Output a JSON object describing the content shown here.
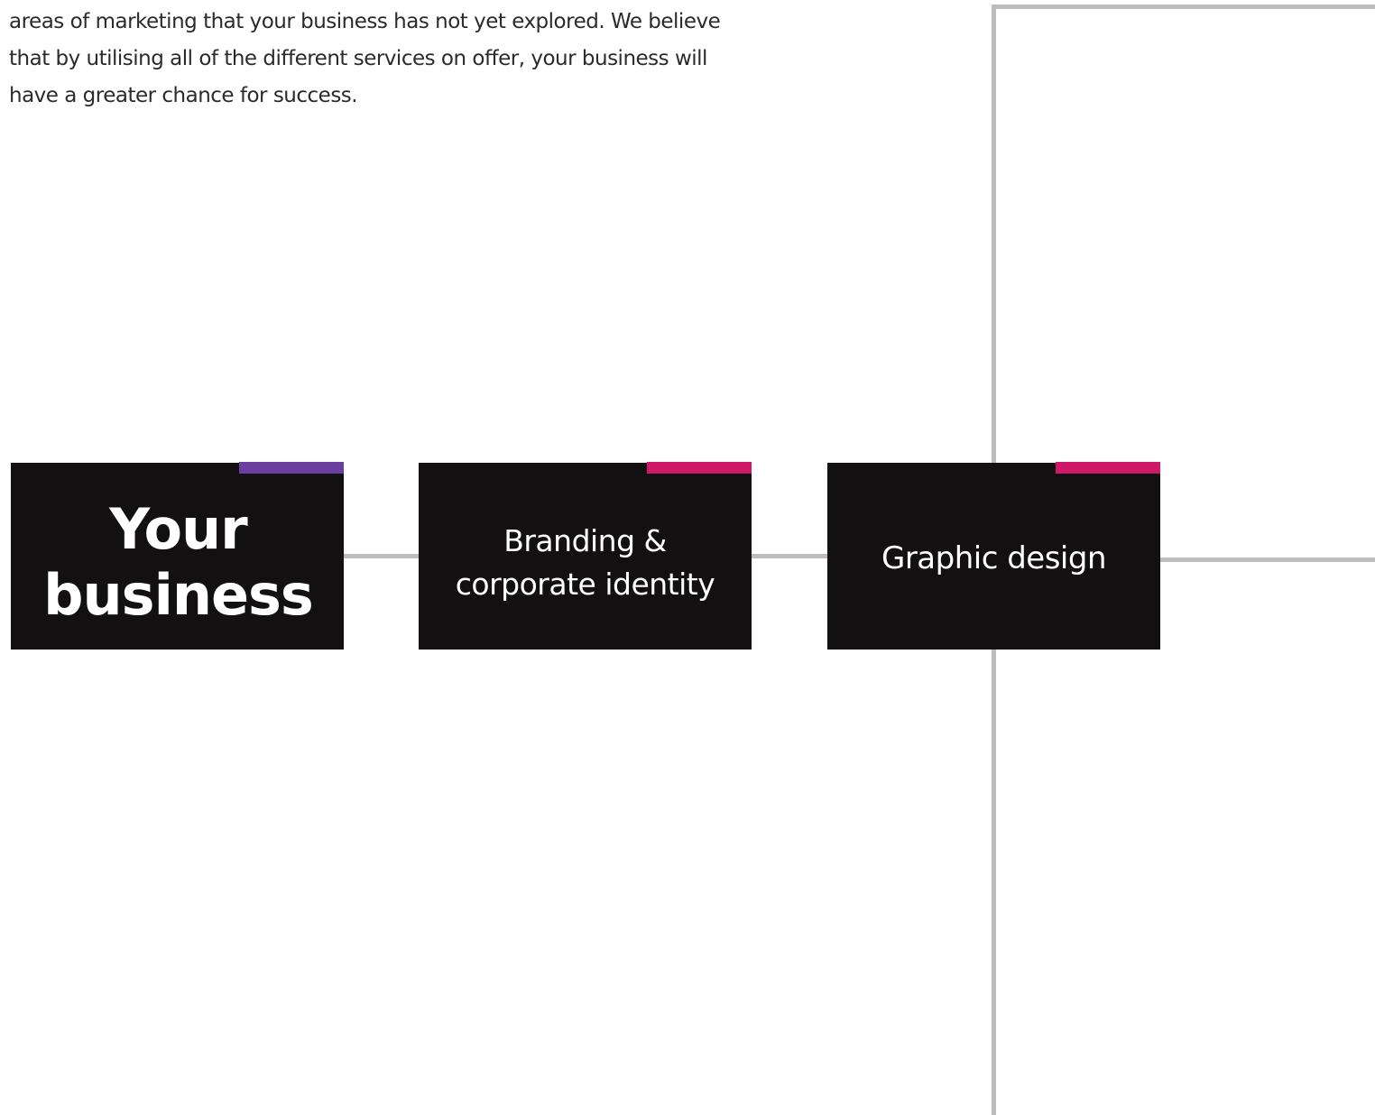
{
  "intro": {
    "lines": [
      "areas of marketing that your business has not yet explored. We believe",
      "that by utilising all of the different services on offer, your business will",
      "have a greater chance for success."
    ]
  },
  "nodes": [
    {
      "label": "Your business",
      "accent_color": "#6b3fa0"
    },
    {
      "label": "Branding & corporate identity",
      "accent_color": "#d0186b"
    },
    {
      "label": "Graphic design",
      "accent_color": "#d0186b"
    }
  ],
  "colors": {
    "box": "#121010",
    "connector": "#bdbdbd",
    "text": "#2b2b2b"
  }
}
